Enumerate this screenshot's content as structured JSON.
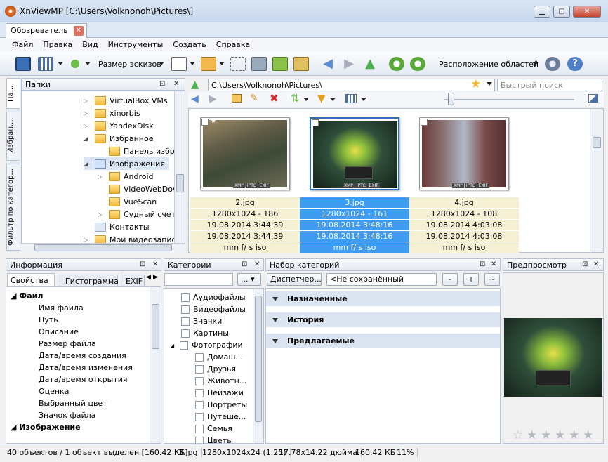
{
  "window": {
    "title": "XnViewMP [C:\\Users\\Volknonoh\\Pictures\\]",
    "min": "▁",
    "max": "▢",
    "close": "✕"
  },
  "tabs": [
    {
      "label": "Обозреватель",
      "close": "✕"
    }
  ],
  "menu": [
    "Файл",
    "Правка",
    "Вид",
    "Инструменты",
    "Создать",
    "Справка"
  ],
  "toolbar": {
    "thumb_size_label": "Размер эскизов",
    "layout_label": "Расположение областей"
  },
  "folders_panel": {
    "vtabs": [
      "Па...",
      "Избран...",
      "Фильтр по категор..."
    ],
    "title": "Папки",
    "items": [
      {
        "label": "VirtualBox VMs",
        "indent": 0,
        "exp": "▷"
      },
      {
        "label": "xinorbis",
        "indent": 0,
        "exp": "▷"
      },
      {
        "label": "YandexDisk",
        "indent": 0,
        "exp": "▷"
      },
      {
        "label": "Избранное",
        "indent": 0,
        "exp": "◢"
      },
      {
        "label": "Панель избр",
        "indent": 1,
        "exp": ""
      },
      {
        "label": "Изображения",
        "indent": 0,
        "exp": "◢"
      },
      {
        "label": "Android",
        "indent": 1,
        "exp": "▷"
      },
      {
        "label": "VideoWebDov",
        "indent": 1,
        "exp": ""
      },
      {
        "label": "VueScan",
        "indent": 1,
        "exp": ""
      },
      {
        "label": "Судный счет",
        "indent": 1,
        "exp": "▷"
      },
      {
        "label": "Контакты",
        "indent": 0,
        "exp": ""
      },
      {
        "label": "Мои видеозапис",
        "indent": 0,
        "exp": "▷"
      }
    ]
  },
  "address": {
    "path": "C:\\Users\\Volknonoh\\Pictures\\",
    "search_placeholder": "Быстрый поиск"
  },
  "thumbnails": [
    {
      "name": "2.jpg",
      "dims": "1280x1024 - 186",
      "date": "19.08.2014 3:44:39",
      "date2": "19.08.2014 3:44:39",
      "exif": "mm f/ s iso",
      "selected": false,
      "badges": [
        "XMP",
        "IPTC",
        "EXIF"
      ]
    },
    {
      "name": "3.jpg",
      "dims": "1280x1024 - 161",
      "date": "19.08.2014 3:48:16",
      "date2": "19.08.2014 3:48:16",
      "exif": "mm f/ s iso",
      "selected": true,
      "badges": [
        "XMP",
        "IPTC",
        "EXIF"
      ]
    },
    {
      "name": "4.jpg",
      "dims": "1280x1024 - 108",
      "date": "19.08.2014 4:03:08",
      "date2": "19.08.2014 4:03:08",
      "exif": "mm f/ s iso",
      "selected": false,
      "badges": [
        "XMP",
        "IPTC",
        "EXIF"
      ]
    }
  ],
  "info_panel": {
    "title": "Информация",
    "tabs": [
      "Свойства",
      "Гистограмма",
      "EXIF"
    ],
    "group": "Файл",
    "rows": [
      "Имя файла",
      "Путь",
      "Описание",
      "Размер файла",
      "Дата/время создания",
      "Дата/время изменения",
      "Дата/время открытия",
      "Оценка",
      "Выбранный цвет",
      "Значок файла"
    ],
    "group2": "Изображение"
  },
  "categories_panel": {
    "title": "Категории",
    "more": "...",
    "items": [
      {
        "label": "Аудиофайлы",
        "indent": 0
      },
      {
        "label": "Видеофайлы",
        "indent": 0
      },
      {
        "label": "Значки",
        "indent": 0
      },
      {
        "label": "Картины",
        "indent": 0
      },
      {
        "label": "Фотографии",
        "indent": 0
      },
      {
        "label": "Домаш...",
        "indent": 1
      },
      {
        "label": "Друзья",
        "indent": 1
      },
      {
        "label": "Животн...",
        "indent": 1
      },
      {
        "label": "Пейзажи",
        "indent": 1
      },
      {
        "label": "Портреты",
        "indent": 1
      },
      {
        "label": "Путеше...",
        "indent": 1
      },
      {
        "label": "Семья",
        "indent": 1
      },
      {
        "label": "Цветы",
        "indent": 1
      }
    ]
  },
  "catset_panel": {
    "title": "Набор категорий",
    "manager": "Диспетчер...",
    "layout_select": "<Не сохранённый макет>",
    "btn_minus": "-",
    "btn_plus": "+",
    "btn_tilde": "~",
    "sections": [
      "Назначенные",
      "История",
      "Предлагаемые"
    ]
  },
  "preview_panel": {
    "title": "Предпросмотр"
  },
  "statusbar": [
    "40 объектов / 1 объект выделен [160.42 КБ]",
    "3.jpg",
    "1280x1024x24 (1.25)",
    "17.78x14.22 дюйма",
    "160.42 КБ",
    "11%"
  ],
  "colors": {
    "selection": "#3f9cf0",
    "info_bg": "#f5f0d4",
    "set_header": "#dbe5f1"
  }
}
